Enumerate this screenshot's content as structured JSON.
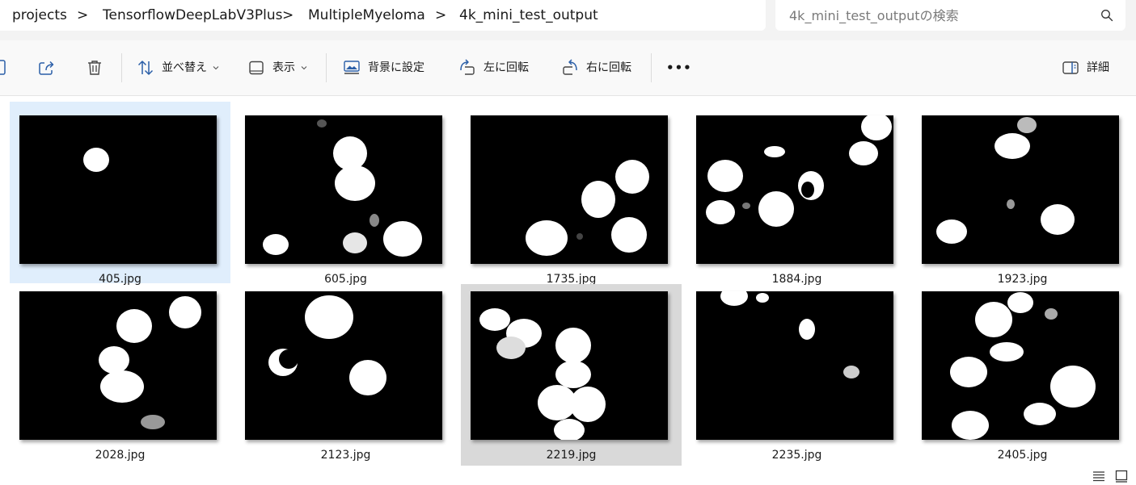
{
  "breadcrumb": {
    "items": [
      "projects",
      "TensorflowDeepLabV3Plus",
      "MultipleMyeloma",
      "4k_mini_test_output"
    ],
    "separator": ">"
  },
  "search": {
    "placeholder": "4k_mini_test_outputの検索",
    "icon": "search-icon"
  },
  "toolbar": {
    "sort_label": "並べ替え",
    "view_label": "表示",
    "set_background_label": "背景に設定",
    "rotate_left_label": "左に回転",
    "rotate_right_label": "右に回転",
    "more_label": "•••",
    "details_label": "詳細",
    "icons": [
      "copy-icon",
      "share-icon",
      "delete-icon",
      "sort-icon",
      "view-icon",
      "set-background-icon",
      "rotate-left-icon",
      "rotate-right-icon",
      "more-icon",
      "details-pane-icon"
    ]
  },
  "files": [
    {
      "name": "405.jpg",
      "state": "selected"
    },
    {
      "name": "605.jpg",
      "state": ""
    },
    {
      "name": "1735.jpg",
      "state": ""
    },
    {
      "name": "1884.jpg",
      "state": ""
    },
    {
      "name": "1923.jpg",
      "state": ""
    },
    {
      "name": "2028.jpg",
      "state": ""
    },
    {
      "name": "2123.jpg",
      "state": ""
    },
    {
      "name": "2219.jpg",
      "state": "hovered"
    },
    {
      "name": "2235.jpg",
      "state": ""
    },
    {
      "name": "2405.jpg",
      "state": ""
    }
  ],
  "statusbar": {
    "icons": [
      "details-view-icon",
      "large-icons-view-icon"
    ]
  },
  "colors": {
    "selected_tile": "#e0eefc",
    "hovered_tile": "#d9d9d9",
    "accent": "#0067c0"
  }
}
